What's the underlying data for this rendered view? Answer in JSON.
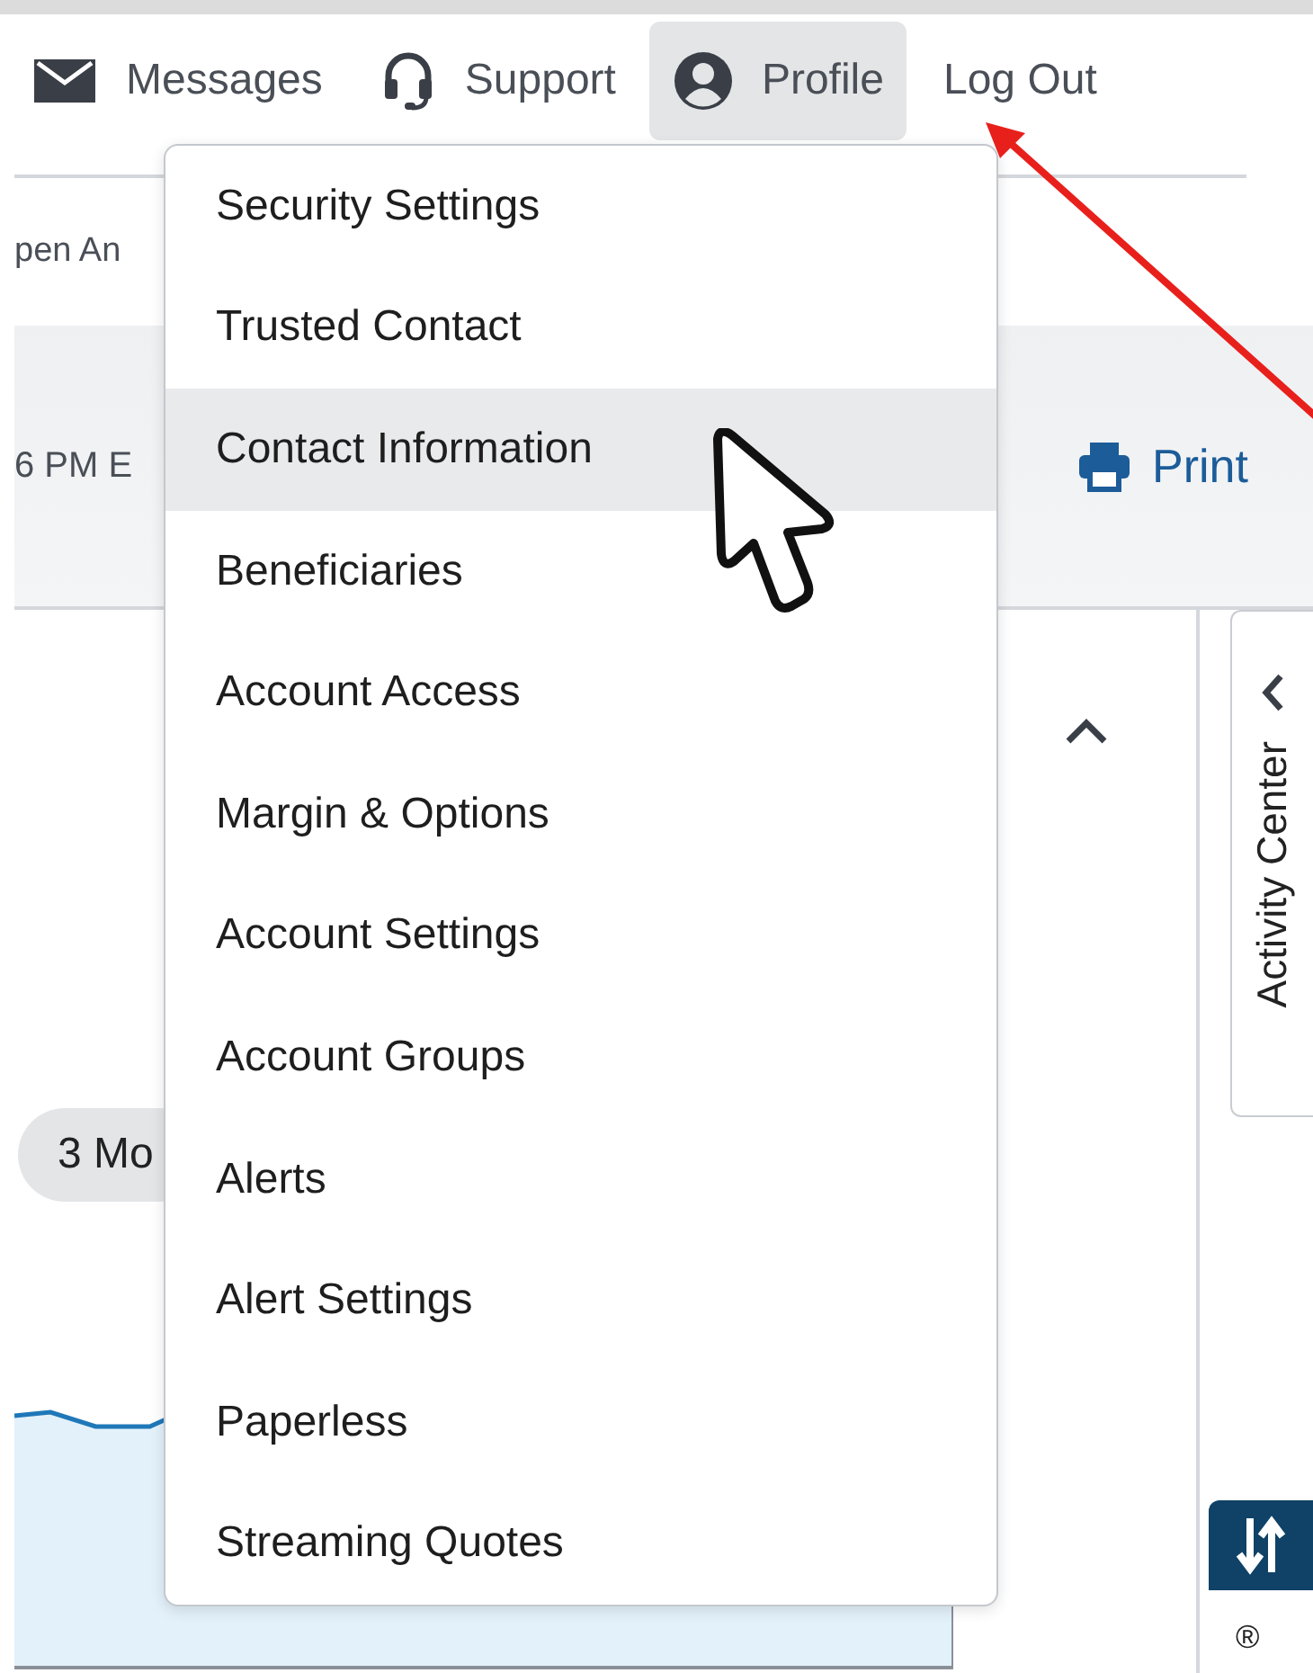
{
  "nav": [
    {
      "kind": "mail",
      "label": "Messages",
      "selected": false
    },
    {
      "kind": "headset",
      "label": "Support",
      "selected": false
    },
    {
      "kind": "user",
      "label": "Profile",
      "selected": true
    },
    {
      "kind": "text",
      "label": "Log Out",
      "selected": false
    }
  ],
  "open_link": "pen An",
  "time_text": "6 PM E",
  "print": "Print",
  "range_button": "3 Mo",
  "side_tab": "Activity Center",
  "corner_mark": "®",
  "profile_menu": {
    "items": [
      {
        "label": "Security Settings",
        "selected": false
      },
      {
        "label": "Trusted Contact",
        "selected": false
      },
      {
        "label": "Contact Information",
        "selected": true
      },
      {
        "label": "Beneficiaries",
        "selected": false
      },
      {
        "label": "Account Access",
        "selected": false
      },
      {
        "label": "Margin & Options",
        "selected": false
      },
      {
        "label": "Account Settings",
        "selected": false
      },
      {
        "label": "Account Groups",
        "selected": false
      },
      {
        "label": "Alerts",
        "selected": false
      },
      {
        "label": "Alert Settings",
        "selected": false
      },
      {
        "label": "Paperless",
        "selected": false
      },
      {
        "label": "Streaming Quotes",
        "selected": false
      }
    ]
  }
}
